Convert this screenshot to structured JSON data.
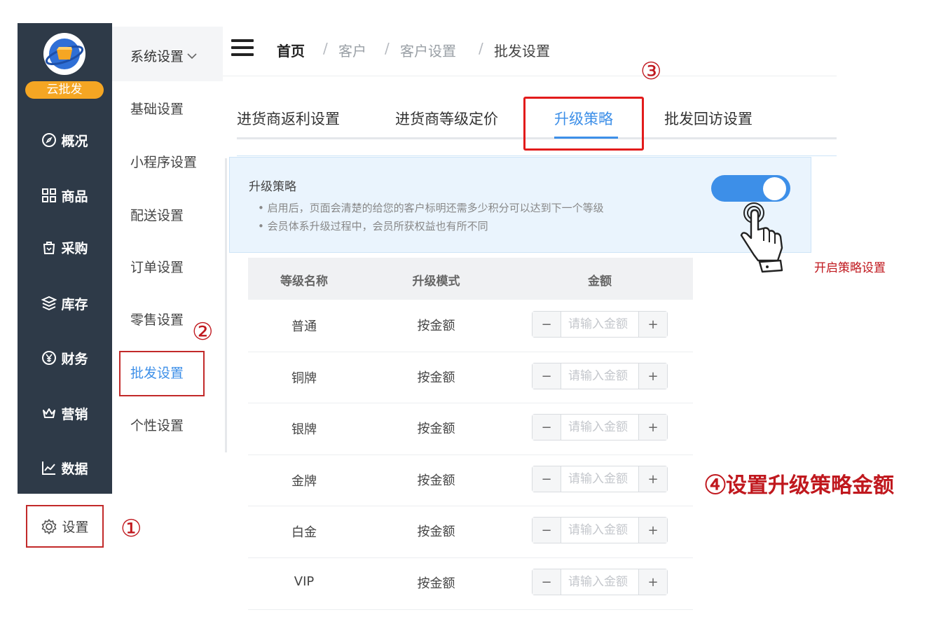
{
  "sidebar": {
    "brand": "云批发",
    "items": [
      {
        "label": "概况",
        "icon": "compass-icon"
      },
      {
        "label": "商品",
        "icon": "grid-icon"
      },
      {
        "label": "采购",
        "icon": "bag-icon"
      },
      {
        "label": "库存",
        "icon": "layers-icon"
      },
      {
        "label": "财务",
        "icon": "yen-icon"
      },
      {
        "label": "营销",
        "icon": "crown-icon"
      },
      {
        "label": "数据",
        "icon": "chart-icon"
      }
    ],
    "settings_label": "设置"
  },
  "submenu": {
    "title": "系统设置",
    "items": [
      "基础设置",
      "小程序设置",
      "配送设置",
      "订单设置",
      "零售设置",
      "批发设置",
      "个性设置"
    ],
    "active": "批发设置"
  },
  "breadcrumb": {
    "items": [
      "首页",
      "客户",
      "客户设置",
      "批发设置"
    ],
    "separator": "/"
  },
  "tabs": {
    "items": [
      "进货商返利设置",
      "进货商等级定价",
      "升级策略",
      "批发回访设置"
    ],
    "active": "升级策略"
  },
  "info": {
    "title": "升级策略",
    "bullets": [
      "启用后，页面会清楚的给您的客户标明还需多少积分可以达到下一个等级",
      "会员体系升级过程中，会员所获权益也有所不同"
    ],
    "toggle_on": true
  },
  "table": {
    "headers": [
      "等级名称",
      "升级模式",
      "金额"
    ],
    "rows": [
      {
        "level": "普通",
        "mode": "按金额"
      },
      {
        "level": "铜牌",
        "mode": "按金额"
      },
      {
        "level": "银牌",
        "mode": "按金额"
      },
      {
        "level": "金牌",
        "mode": "按金额"
      },
      {
        "level": "白金",
        "mode": "按金额"
      },
      {
        "level": "VIP",
        "mode": "按金额"
      }
    ],
    "amount_placeholder": "请输入金额",
    "minus_label": "−",
    "plus_label": "+"
  },
  "annotations": {
    "step1": "①",
    "step2": "②",
    "step3": "③",
    "step4": "④设置升级策略金额",
    "toggle_hint": "开启策略设置"
  },
  "colors": {
    "sidebar_bg": "#2e3a48",
    "accent": "#3d8fe8",
    "brand_badge": "#f5a623",
    "highlight_box": "#c22a2a",
    "annotation": "#c0181e"
  }
}
